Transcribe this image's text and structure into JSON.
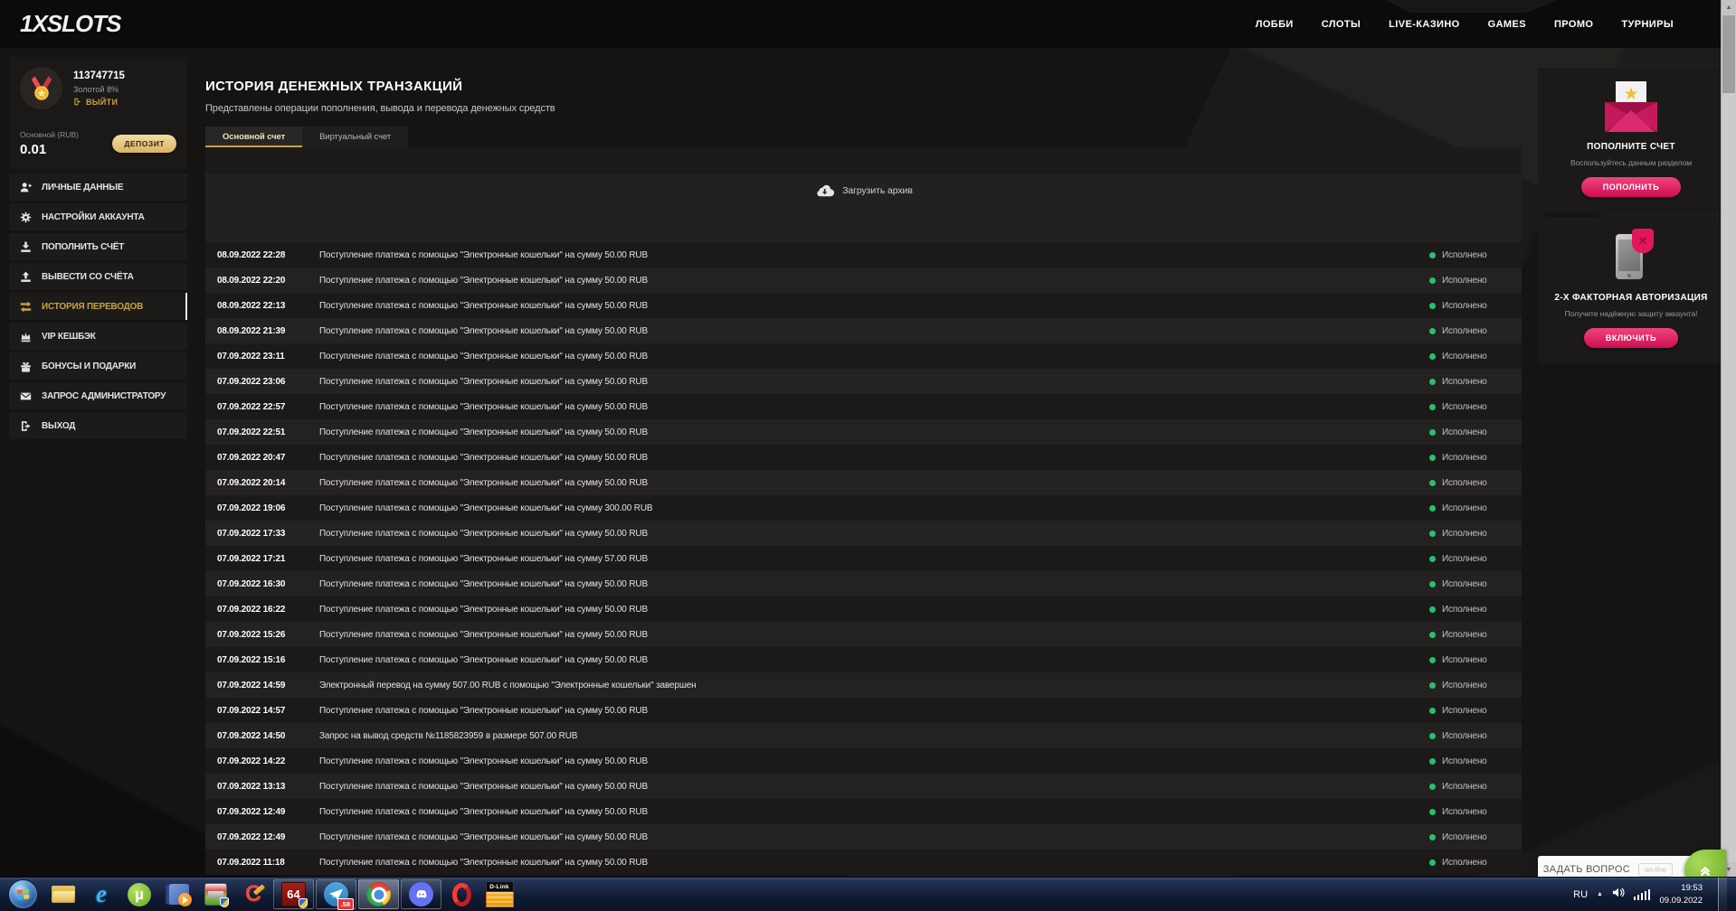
{
  "header": {
    "logo": "1XSLOTS",
    "nav": [
      {
        "key": "lobby",
        "label": "ЛОББИ"
      },
      {
        "key": "slots",
        "label": "СЛОТЫ"
      },
      {
        "key": "live-casino",
        "label": "LIVE-КАЗИНО"
      },
      {
        "key": "games",
        "label": "GAMES"
      },
      {
        "key": "promo",
        "label": "ПРОМО"
      },
      {
        "key": "tournaments",
        "label": "ТУРНИРЫ"
      }
    ]
  },
  "sidebar": {
    "user_id": "113747715",
    "level": "Золотой 8%",
    "logout_label": "ВЫЙТИ",
    "balance_label": "Основной (RUB)",
    "balance_value": "0.01",
    "deposit_button": "ДЕПОЗИТ",
    "menu": [
      {
        "key": "personal-data",
        "label": "ЛИЧНЫЕ ДАННЫЕ",
        "icon": "i-user",
        "icon_name": "user-icon",
        "active": false
      },
      {
        "key": "account-settings",
        "label": "НАСТРОЙКИ АККАУНТА",
        "icon": "i-gears",
        "icon_name": "gears-icon",
        "active": false
      },
      {
        "key": "deposit",
        "label": "ПОПОЛНИТЬ СЧЁТ",
        "icon": "i-download",
        "icon_name": "deposit-icon",
        "active": false
      },
      {
        "key": "withdraw",
        "label": "ВЫВЕСТИ СО СЧЁТА",
        "icon": "i-upload",
        "icon_name": "withdraw-icon",
        "active": false
      },
      {
        "key": "transfer-history",
        "label": "ИСТОРИЯ ПЕРЕВОДОВ",
        "icon": "i-transfer",
        "icon_name": "transfer-icon",
        "active": true
      },
      {
        "key": "vip-cashback",
        "label": "VIP КЕШБЭК",
        "icon": "i-crown",
        "icon_name": "crown-icon",
        "active": false
      },
      {
        "key": "bonuses",
        "label": "БОНУСЫ И ПОДАРКИ",
        "icon": "i-gift",
        "icon_name": "gift-icon",
        "active": false
      },
      {
        "key": "admin-request",
        "label": "ЗАПРОС АДМИНИСТРАТОРУ",
        "icon": "i-envelope",
        "icon_name": "envelope-icon",
        "active": false
      },
      {
        "key": "logout",
        "label": "ВЫХОД",
        "icon": "i-exit",
        "icon_name": "exit-icon",
        "active": false
      }
    ]
  },
  "main": {
    "title": "ИСТОРИЯ ДЕНЕЖНЫХ ТРАНЗАКЦИЙ",
    "subtitle": "Представлены операции пополнения, вывода и перевода денежных средств",
    "tabs": [
      {
        "label": "Основной счет",
        "active": true
      },
      {
        "label": "Виртуальный счет",
        "active": false
      }
    ],
    "download_archive": "Загрузить архив",
    "transactions": [
      {
        "datetime": "08.09.2022 22:28",
        "description": "Поступление платежа с помощью \"Электронные кошельки\" на сумму 50.00 RUB",
        "status": "Исполнено"
      },
      {
        "datetime": "08.09.2022 22:20",
        "description": "Поступление платежа с помощью \"Электронные кошельки\" на сумму 50.00 RUB",
        "status": "Исполнено"
      },
      {
        "datetime": "08.09.2022 22:13",
        "description": "Поступление платежа с помощью \"Электронные кошельки\" на сумму 50.00 RUB",
        "status": "Исполнено"
      },
      {
        "datetime": "08.09.2022 21:39",
        "description": "Поступление платежа с помощью \"Электронные кошельки\" на сумму 50.00 RUB",
        "status": "Исполнено"
      },
      {
        "datetime": "07.09.2022 23:11",
        "description": "Поступление платежа с помощью \"Электронные кошельки\" на сумму 50.00 RUB",
        "status": "Исполнено"
      },
      {
        "datetime": "07.09.2022 23:06",
        "description": "Поступление платежа с помощью \"Электронные кошельки\" на сумму 50.00 RUB",
        "status": "Исполнено"
      },
      {
        "datetime": "07.09.2022 22:57",
        "description": "Поступление платежа с помощью \"Электронные кошельки\" на сумму 50.00 RUB",
        "status": "Исполнено"
      },
      {
        "datetime": "07.09.2022 22:51",
        "description": "Поступление платежа с помощью \"Электронные кошельки\" на сумму 50.00 RUB",
        "status": "Исполнено"
      },
      {
        "datetime": "07.09.2022 20:47",
        "description": "Поступление платежа с помощью \"Электронные кошельки\" на сумму 50.00 RUB",
        "status": "Исполнено"
      },
      {
        "datetime": "07.09.2022 20:14",
        "description": "Поступление платежа с помощью \"Электронные кошельки\" на сумму 50.00 RUB",
        "status": "Исполнено"
      },
      {
        "datetime": "07.09.2022 19:06",
        "description": "Поступление платежа с помощью \"Электронные кошельки\" на сумму 300.00 RUB",
        "status": "Исполнено"
      },
      {
        "datetime": "07.09.2022 17:33",
        "description": "Поступление платежа с помощью \"Электронные кошельки\" на сумму 50.00 RUB",
        "status": "Исполнено"
      },
      {
        "datetime": "07.09.2022 17:21",
        "description": "Поступление платежа с помощью \"Электронные кошельки\" на сумму 57.00 RUB",
        "status": "Исполнено"
      },
      {
        "datetime": "07.09.2022 16:30",
        "description": "Поступление платежа с помощью \"Электронные кошельки\" на сумму 50.00 RUB",
        "status": "Исполнено"
      },
      {
        "datetime": "07.09.2022 16:22",
        "description": "Поступление платежа с помощью \"Электронные кошельки\" на сумму 50.00 RUB",
        "status": "Исполнено"
      },
      {
        "datetime": "07.09.2022 15:26",
        "description": "Поступление платежа с помощью \"Электронные кошельки\" на сумму 50.00 RUB",
        "status": "Исполнено"
      },
      {
        "datetime": "07.09.2022 15:16",
        "description": "Поступление платежа с помощью \"Электронные кошельки\" на сумму 50.00 RUB",
        "status": "Исполнено"
      },
      {
        "datetime": "07.09.2022 14:59",
        "description": "Электронный перевод на сумму 507.00 RUB с помощью \"Электронные кошельки\" завершен",
        "status": "Исполнено"
      },
      {
        "datetime": "07.09.2022 14:57",
        "description": "Поступление платежа с помощью \"Электронные кошельки\" на сумму 50.00 RUB",
        "status": "Исполнено"
      },
      {
        "datetime": "07.09.2022 14:50",
        "description": "Запрос на вывод средств №1185823959 в размере 507.00 RUB",
        "status": "Исполнено"
      },
      {
        "datetime": "07.09.2022 14:22",
        "description": "Поступление платежа с помощью \"Электронные кошельки\" на сумму 50.00 RUB",
        "status": "Исполнено"
      },
      {
        "datetime": "07.09.2022 13:13",
        "description": "Поступление платежа с помощью \"Электронные кошельки\" на сумму 50.00 RUB",
        "status": "Исполнено"
      },
      {
        "datetime": "07.09.2022 12:49",
        "description": "Поступление платежа с помощью \"Электронные кошельки\" на сумму 50.00 RUB",
        "status": "Исполнено"
      },
      {
        "datetime": "07.09.2022 12:49",
        "description": "Поступление платежа с помощью \"Электронные кошельки\" на сумму 50.00 RUB",
        "status": "Исполнено"
      },
      {
        "datetime": "07.09.2022 11:18",
        "description": "Поступление платежа с помощью \"Электронные кошельки\" на сумму 50.00 RUB",
        "status": "Исполнено"
      }
    ]
  },
  "right_panels": [
    {
      "title": "ПОПОЛНИТЕ СЧЕТ",
      "subtitle": "Воспользуйтесь данным разделом",
      "button": "ПОПОЛНИТЬ",
      "icon": "envelope-star-icon"
    },
    {
      "title": "2-Х ФАКТОРНАЯ АВТОРИЗАЦИЯ",
      "subtitle": "Получите надёжную защиту аккаунта!",
      "button": "ВКЛЮЧИТЬ",
      "icon": "phone-shield-icon"
    }
  ],
  "chat_widget": {
    "label": "ЗАДАТЬ ВОПРОС",
    "badge": "on-line"
  },
  "taskbar": {
    "language": "RU",
    "time": "19:53",
    "date": "09.09.2022",
    "app_labels": {
      "ie": "e",
      "utorrent": "µ",
      "ccleaner": "C",
      "aida64": "64",
      "telegram_badge": ".58",
      "dlink": "D-Link"
    }
  },
  "colors": {
    "accent_gold": "#c9a144",
    "pink": "#d81b5e",
    "status_green": "#2abf6e",
    "chat_green": "#7cb82f",
    "header_bg": "#0b0b0b",
    "panel_bg": "#232120",
    "row_dark": "#1b1a19",
    "row_light": "#242221"
  }
}
